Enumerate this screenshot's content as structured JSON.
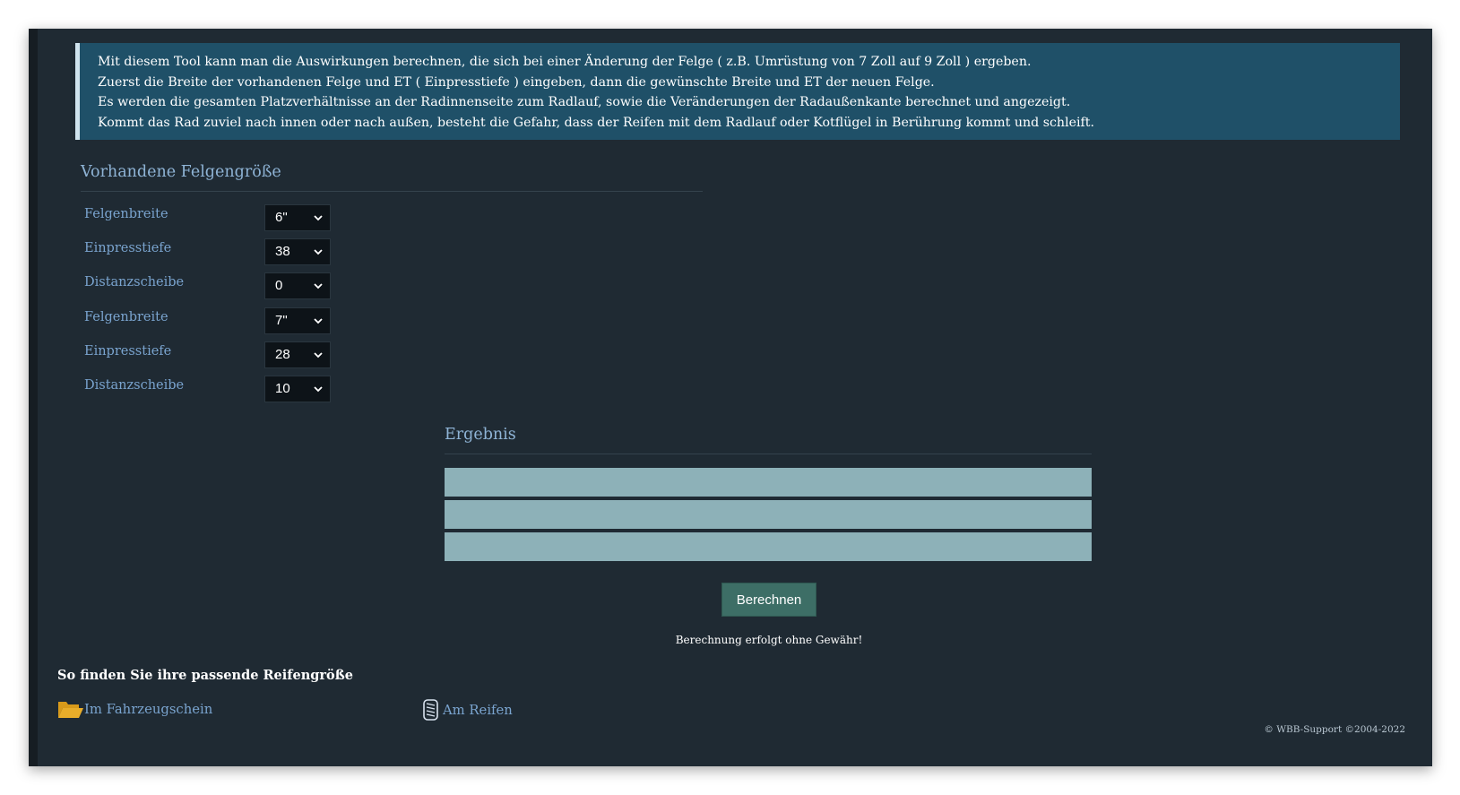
{
  "info": {
    "line1": "Mit diesem Tool kann man die Auswirkungen berechnen, die sich bei einer Änderung der Felge ( z.B. Umrüstung von 7 Zoll auf 9 Zoll ) ergeben.",
    "line2": "Zuerst die Breite der vorhandenen Felge und ET ( Einpresstiefe ) eingeben, dann die gewünschte Breite und ET der neuen Felge.",
    "line3": "Es werden die gesamten Platzverhältnisse an der Radinnenseite zum Radlauf, sowie die Veränderungen der Radaußenkante berechnet und angezeigt.",
    "line4": "Kommt das Rad zuviel nach innen oder nach außen, besteht die Gefahr, dass der Reifen mit dem Radlauf oder Kotflügel in Berührung kommt und schleift."
  },
  "form": {
    "title": "Vorhandene Felgengröße",
    "fields": [
      {
        "label": "Felgenbreite",
        "value": "6\""
      },
      {
        "label": "Einpresstiefe",
        "value": "38"
      },
      {
        "label": "Distanzscheibe",
        "value": "0"
      },
      {
        "label": "Felgenbreite",
        "value": "7\""
      },
      {
        "label": "Einpresstiefe",
        "value": "28"
      },
      {
        "label": "Distanzscheibe",
        "value": "10"
      }
    ]
  },
  "result": {
    "title": "Ergebnis",
    "row1": "",
    "row2": "",
    "row3": ""
  },
  "actions": {
    "calculate_label": "Berechnen",
    "disclaimer": "Berechnung erfolgt ohne Gewähr!"
  },
  "howto": {
    "heading": "So finden Sie ihre passende Reifengröße",
    "link1": "Im Fahrzeugschein",
    "link2": "Am Reifen"
  },
  "footer": {
    "copyright": "© WBB-Support ©2004-2022"
  },
  "colors": {
    "page_bg": "#1f2a33",
    "info_bg": "#1f5068",
    "label": "#7aa4cf",
    "result_bar": "#8db1b8",
    "button": "#3d6e66"
  }
}
